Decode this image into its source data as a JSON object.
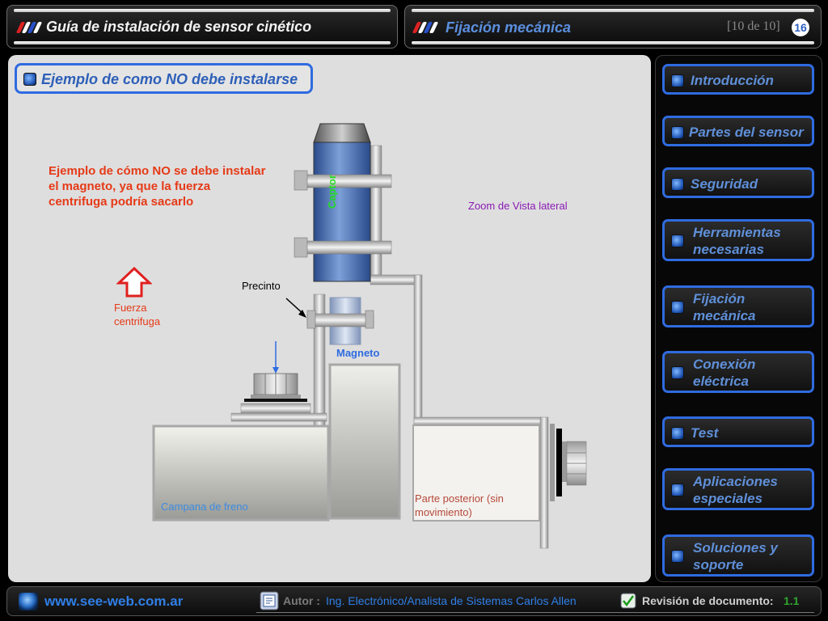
{
  "header": {
    "main_title": "Guía de instalación de sensor cinético",
    "section_title": "Fijación mecánica",
    "page_counter": "[10 de 10]",
    "page_badge": "16"
  },
  "content": {
    "section_heading": "Ejemplo de como NO debe instalarse",
    "warning_text": "Ejemplo de cómo NO se debe instalar el magneto, ya que la fuerza centrifuga podría sacarlo",
    "force_label": "Fuerza centrifuga",
    "zoom_label": "Zoom de Vista lateral",
    "captor_label": "Captor",
    "precinto_label": "Precinto",
    "magneto_label": "Magneto",
    "campana_label": "Campana de freno",
    "parte_label": "Parte posterior (sin movimiento)"
  },
  "nav": {
    "items": [
      {
        "label": "Introducción"
      },
      {
        "label": "Partes del sensor"
      },
      {
        "label": "Seguridad"
      },
      {
        "label": "Herramientas necesarias"
      },
      {
        "label": "Fijación mecánica"
      },
      {
        "label": "Conexión eléctrica"
      },
      {
        "label": "Test"
      },
      {
        "label": "Aplicaciones especiales"
      },
      {
        "label": "Soluciones y soporte"
      }
    ]
  },
  "footer": {
    "website": "www.see-web.com.ar",
    "autor_label": "Autor :",
    "autor_name": "Ing. Electrónico/Analista de Sistemas Carlos Allen",
    "revision_label": "Revisión de documento:",
    "revision_value": "1.1"
  },
  "colors": {
    "accent_blue": "#2f6be0",
    "warning_red": "#e63a17",
    "zoom_purple": "#8a1ab5",
    "captor_green": "#22dd22",
    "revision_green": "#2ea82e"
  },
  "icons": [
    "flag-stripes-icon",
    "flag-stripes-icon",
    "bullet-square-icon",
    "up-arrow-icon",
    "globe-icon",
    "document-icon",
    "checkmark-icon"
  ]
}
